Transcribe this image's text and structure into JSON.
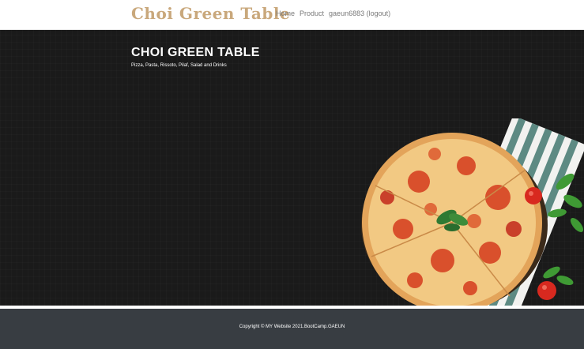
{
  "navbar": {
    "brand": "Choi Green Table",
    "links": [
      {
        "label": "Home"
      },
      {
        "label": "Product"
      },
      {
        "label": "gaeun6883 (logout)"
      }
    ]
  },
  "hero": {
    "title": "CHOI GREEN TABLE",
    "subtitle": "Pizza, Pasta, Rissoto, Pilaf, Salad and Drinks"
  },
  "footer": {
    "copyright": "Copyright © MY Website 2021.BootCamp.GAEUN"
  },
  "colors": {
    "brand": "#c9a87c",
    "hero_bg": "#1a1a1a",
    "footer_bg": "#383d42",
    "nav_link": "#7a7a7a"
  }
}
